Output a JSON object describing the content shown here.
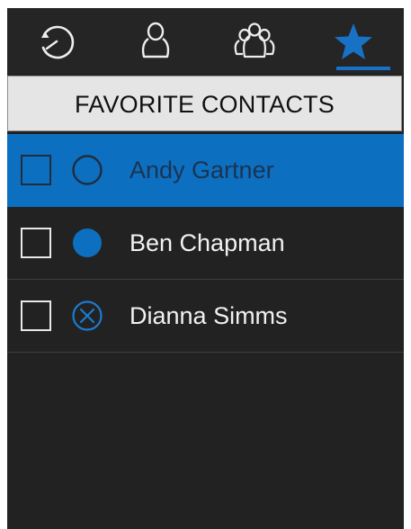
{
  "tabs": [
    {
      "icon": "history-icon",
      "active": false
    },
    {
      "icon": "contact-icon",
      "active": false
    },
    {
      "icon": "group-icon",
      "active": false
    },
    {
      "icon": "star-icon",
      "active": true
    }
  ],
  "colors": {
    "accent": "#1772c6",
    "selected_row": "#0d6fc0",
    "background": "#222222",
    "header_bg": "#e5e5e5"
  },
  "header": {
    "title": "FAVORITE CONTACTS"
  },
  "contacts": [
    {
      "name": "Andy Gartner",
      "status": "offline",
      "status_icon": "circle-outline-icon",
      "checked": false,
      "selected": true
    },
    {
      "name": "Ben Chapman",
      "status": "available",
      "status_icon": "circle-filled-icon",
      "checked": false,
      "selected": false
    },
    {
      "name": "Dianna Simms",
      "status": "do-not-disturb",
      "status_icon": "circle-x-icon",
      "checked": false,
      "selected": false
    }
  ]
}
